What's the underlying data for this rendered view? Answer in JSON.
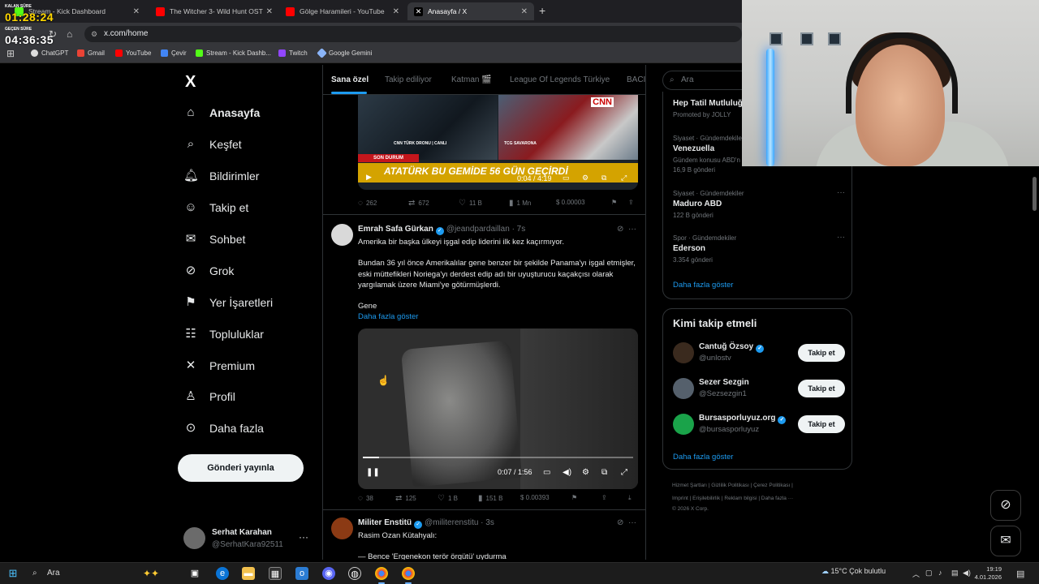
{
  "browser": {
    "tabs": [
      {
        "label": "Stream - Kick Dashboard",
        "color": "#53fc18"
      },
      {
        "label": "The Witcher 3- Wild Hunt OST",
        "color": "#ff0000"
      },
      {
        "label": "Gölge Haramileri - YouTube",
        "color": "#ff0000"
      },
      {
        "label": "Anasayfa / X",
        "color": "#ffffff"
      }
    ],
    "new_tab": "+",
    "url": "x.com/home",
    "bookmarks": [
      "ChatGPT",
      "Gmail",
      "YouTube",
      "Çevir",
      "Stream - Kick Dashb...",
      "Twitch",
      "Google Gemini"
    ]
  },
  "overlay": {
    "remaining_label": "KALAN SÜRE",
    "remaining_time": "01:28:24",
    "elapsed_label": "GEÇEN SÜRE",
    "elapsed_time": "04:36:35"
  },
  "nav": {
    "logo": "X",
    "items": [
      {
        "label": "Anasayfa",
        "icon": "home-icon",
        "glyph": "⌂"
      },
      {
        "label": "Keşfet",
        "icon": "search-icon",
        "glyph": "⌕"
      },
      {
        "label": "Bildirimler",
        "icon": "bell-icon",
        "glyph": "♫"
      },
      {
        "label": "Takip et",
        "icon": "add-user-icon",
        "glyph": "☺"
      },
      {
        "label": "Sohbet",
        "icon": "mail-icon",
        "glyph": "✉"
      },
      {
        "label": "Grok",
        "icon": "grok-icon",
        "glyph": "⊘"
      },
      {
        "label": "Yer İşaretleri",
        "icon": "bookmark-icon",
        "glyph": "⚑"
      },
      {
        "label": "Topluluklar",
        "icon": "communities-icon",
        "glyph": "☷"
      },
      {
        "label": "Premium",
        "icon": "x-premium-icon",
        "glyph": "✕"
      },
      {
        "label": "Profil",
        "icon": "profile-icon",
        "glyph": "♙"
      },
      {
        "label": "Daha fazla",
        "icon": "more-circle-icon",
        "glyph": "⊙"
      }
    ],
    "post_button": "Gönderi yayınla",
    "account": {
      "name": "Serhat Karahan",
      "handle": "@SerhatKara92511"
    }
  },
  "feed": {
    "tabs": [
      "Sana özel",
      "Takip ediliyor",
      "Katman 🎬",
      "League Of Legends Türkiye",
      "BACIL"
    ],
    "top_media": {
      "caption_left": "CNN TÜRK DRONU | CANLI",
      "caption_right": "TCG SAVARONA",
      "breaking": "SON DURUM",
      "banner": "ATATÜRK BU GEMİDE 56 GÜN GEÇİRDİ",
      "logo": "CNN",
      "time": "0:04 / 4:19"
    },
    "top_actions": {
      "replies": "262",
      "reposts": "672",
      "likes": "11 B",
      "views": "1 Mn",
      "tips": "$ 0.00003"
    },
    "tweet1": {
      "name": "Emrah Safa Gürkan",
      "handle": "@jeandpardaillan · 7s",
      "line1": "Amerika bir başka ülkeyi işgal edip liderini ilk kez kaçırmıyor.",
      "line2": "Bundan 36 yıl önce Amerikalılar gene benzer bir şekilde Panama'yı işgal etmişler, eski müttefikleri Noriega'yı derdest edip adı bir uyuşturucu kaçakçısı olarak yargılamak üzere Miami'ye götürmüşlerdi.",
      "line3": "Gene",
      "show_more": "Daha fazla göster",
      "video_time": "0:07 / 1:56",
      "video_progress": 0.06,
      "actions": {
        "replies": "38",
        "reposts": "125",
        "likes": "1 B",
        "views": "151 B",
        "tips": "$ 0.00393"
      }
    },
    "tweet2": {
      "name": "Militer Enstitü",
      "handle": "@militerenstitu · 3s",
      "line1": "Rasim Ozan Kütahyalı:",
      "line2": "— Bence 'Ergenekon terör örgütü' uydurma"
    }
  },
  "sidebar": {
    "search_placeholder": "Ara",
    "promo": {
      "title": "Hep Tatil Mutluluğ",
      "sub": "Promoted by JOLLY"
    },
    "trends": [
      {
        "context": "Siyaset · Gündemdekiler",
        "title": "Venezuella",
        "count": "Gündem konusu ABD'n",
        "count2": "16,9 B gönderi"
      },
      {
        "context": "Siyaset · Gündemdekiler",
        "title": "Maduro ABD",
        "count": "122 B gönderi"
      },
      {
        "context": "Spor · Gündemdekiler",
        "title": "Ederson",
        "count": "3.354 gönderi"
      }
    ],
    "trends_more": "Daha fazla göster",
    "who_title": "Kimi takip etmeli",
    "who": [
      {
        "name": "Cantuğ Özsoy",
        "handle": "@unlostv",
        "button": "Takip et",
        "color": "#3a2a1e"
      },
      {
        "name": "Sezer Sezgin",
        "handle": "@Sezsezgin1",
        "button": "Takip et",
        "color": "#55606c"
      },
      {
        "name": "Bursasporluyuz.org",
        "handle": "@bursasporluyuz",
        "button": "Takip et",
        "color": "#1aa34a"
      }
    ],
    "who_more": "Daha fazla göster",
    "footer1": "Hizmet Şartları  |  Gizlilik Politikası  |  Çerez Politikası  |",
    "footer2": "Imprint  |  Erişilebilirlik  |  Reklam bilgisi  |  Daha fazla ···",
    "footer3": "© 2026 X Corp."
  },
  "taskbar": {
    "search": "Ara",
    "weather": "15°C  Çok bulutlu",
    "time": "19:19",
    "date": "4.01.2026"
  }
}
